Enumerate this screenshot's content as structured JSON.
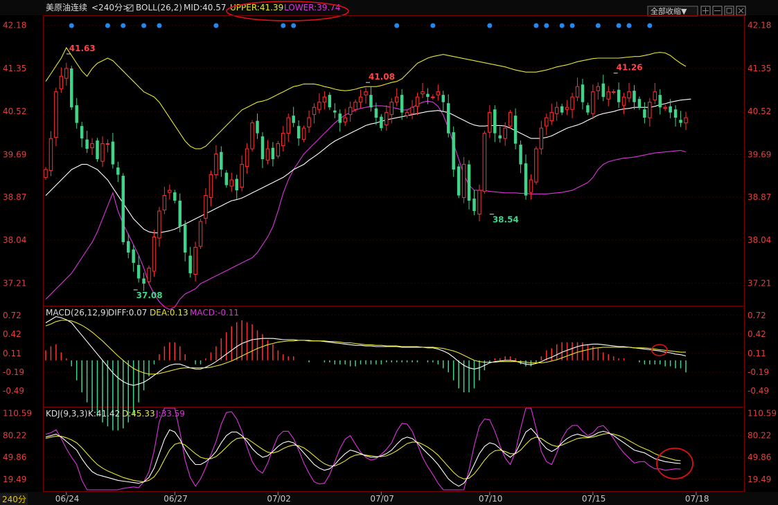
{
  "toolbar": {
    "instrument": "美原油连续",
    "period": "<240分>",
    "all_collapse_label": "全部收缩▼",
    "period_badge": "240分"
  },
  "chart_data": {
    "type": "candlestick",
    "colors": {
      "background": "#000000",
      "up": "#ff3232",
      "down": "#40d38a",
      "mid": "#ffffff",
      "upper": "#e6e633",
      "lower": "#dd33dd",
      "axis_text": "#e04040",
      "date_text": "#c8c8c8",
      "grid": "#3a0000",
      "markers": "#2288ee"
    },
    "price_panel": {
      "indicator": "BOLL(26,2)",
      "mid_label": "MID:40.57",
      "upper_label": "UPPER:41.39",
      "lower_label": "LOWER:39.74",
      "ylim": [
        36.8,
        42.35
      ],
      "y_ticks": [
        "42.18",
        "41.35",
        "40.52",
        "39.69",
        "38.87",
        "38.04",
        "37.21"
      ],
      "y_tick_values": [
        42.18,
        41.35,
        40.52,
        39.69,
        38.87,
        38.04,
        37.21
      ],
      "x_labels": [
        "06/24",
        "06/27",
        "07/02",
        "07/07",
        "07/10",
        "07/15",
        "07/18"
      ],
      "x_label_index": [
        4,
        25,
        45,
        65,
        86,
        106,
        126
      ],
      "annotations": [
        {
          "text": "41.63",
          "index": 4,
          "value": 41.63,
          "pos": "above"
        },
        {
          "text": "37.08",
          "index": 17,
          "value": 37.08,
          "pos": "below"
        },
        {
          "text": "41.08",
          "index": 62,
          "value": 41.08,
          "pos": "above"
        },
        {
          "text": "38.54",
          "index": 86,
          "value": 38.54,
          "pos": "below"
        },
        {
          "text": "41.26",
          "index": 110,
          "value": 41.26,
          "pos": "above"
        }
      ],
      "marker_index": [
        5,
        12,
        15,
        19,
        22,
        33,
        46,
        48,
        68,
        75,
        86,
        95,
        97,
        100,
        102,
        107,
        111,
        113,
        117
      ],
      "close": [
        39.4,
        40.0,
        40.9,
        41.2,
        41.35,
        40.6,
        40.3,
        40.0,
        39.8,
        39.9,
        39.6,
        39.9,
        39.9,
        39.5,
        39.3,
        38.0,
        37.8,
        37.6,
        37.3,
        37.2,
        37.5,
        38.1,
        38.6,
        38.9,
        39.0,
        38.8,
        38.3,
        37.8,
        37.4,
        37.9,
        38.4,
        38.9,
        39.3,
        39.7,
        39.4,
        39.1,
        39.2,
        39.0,
        39.5,
        39.8,
        40.3,
        40.1,
        39.6,
        39.8,
        39.6,
        39.9,
        40.1,
        40.4,
        40.3,
        40.0,
        40.2,
        40.4,
        40.6,
        40.7,
        40.8,
        40.6,
        40.5,
        40.3,
        40.4,
        40.6,
        40.7,
        40.8,
        40.9,
        40.6,
        40.4,
        40.2,
        40.5,
        40.7,
        40.8,
        40.5,
        40.5,
        40.6,
        40.8,
        40.9,
        40.8,
        40.8,
        40.9,
        40.7,
        40.1,
        39.4,
        38.9,
        39.5,
        38.8,
        38.6,
        39.0,
        40.1,
        40.5,
        40.1,
        40.0,
        40.2,
        40.5,
        39.9,
        39.5,
        38.9,
        39.2,
        39.8,
        40.2,
        40.4,
        40.5,
        40.6,
        40.5,
        40.6,
        40.8,
        41.0,
        40.7,
        40.5,
        40.9,
        41.0,
        40.8,
        40.9,
        40.9,
        40.7,
        40.8,
        40.9,
        40.7,
        40.6,
        40.4,
        40.7,
        40.9,
        40.6,
        40.6,
        40.5,
        40.4,
        40.3,
        40.4
      ],
      "mid": [
        38.9,
        39.0,
        39.1,
        39.2,
        39.3,
        39.4,
        39.45,
        39.5,
        39.5,
        39.45,
        39.4,
        39.3,
        39.2,
        39.05,
        38.9,
        38.75,
        38.6,
        38.45,
        38.35,
        38.25,
        38.2,
        38.18,
        38.18,
        38.2,
        38.22,
        38.25,
        38.3,
        38.35,
        38.4,
        38.45,
        38.5,
        38.55,
        38.6,
        38.65,
        38.7,
        38.75,
        38.8,
        38.82,
        38.85,
        38.9,
        38.95,
        39.0,
        39.05,
        39.1,
        39.15,
        39.2,
        39.25,
        39.32,
        39.4,
        39.45,
        39.5,
        39.58,
        39.65,
        39.72,
        39.8,
        39.88,
        39.95,
        40.0,
        40.05,
        40.1,
        40.15,
        40.2,
        40.25,
        40.28,
        40.3,
        40.33,
        40.36,
        40.38,
        40.4,
        40.42,
        40.44,
        40.46,
        40.48,
        40.5,
        40.52,
        40.53,
        40.54,
        40.52,
        40.5,
        40.45,
        40.4,
        40.35,
        40.3,
        40.26,
        40.24,
        40.24,
        40.25,
        40.25,
        40.25,
        40.24,
        40.2,
        40.15,
        40.1,
        40.05,
        40.0,
        40.0,
        40.0,
        40.02,
        40.05,
        40.1,
        40.15,
        40.2,
        40.23,
        40.26,
        40.3,
        40.35,
        40.4,
        40.45,
        40.48,
        40.5,
        40.52,
        40.55,
        40.57,
        40.58,
        40.6,
        40.6,
        40.6,
        40.6,
        40.62,
        40.65,
        40.67,
        40.7,
        40.72,
        40.74,
        40.75,
        40.76
      ],
      "upper": [
        41.1,
        41.25,
        41.4,
        41.55,
        41.75,
        41.6,
        41.45,
        41.3,
        41.2,
        41.35,
        41.45,
        41.5,
        41.55,
        41.5,
        41.4,
        41.3,
        41.2,
        41.1,
        41.0,
        40.9,
        40.85,
        40.8,
        40.7,
        40.55,
        40.4,
        40.25,
        40.1,
        39.95,
        39.85,
        39.8,
        39.8,
        39.85,
        39.95,
        40.05,
        40.15,
        40.25,
        40.35,
        40.45,
        40.55,
        40.6,
        40.65,
        40.7,
        40.72,
        40.75,
        40.8,
        40.85,
        40.9,
        40.95,
        41.0,
        41.02,
        41.05,
        41.05,
        41.05,
        41.03,
        41.0,
        40.98,
        40.95,
        40.93,
        40.92,
        40.93,
        40.95,
        40.98,
        41.0,
        41.0,
        41.0,
        41.02,
        41.05,
        41.08,
        41.1,
        41.15,
        41.25,
        41.35,
        41.45,
        41.5,
        41.55,
        41.58,
        41.6,
        41.62,
        41.6,
        41.58,
        41.56,
        41.54,
        41.52,
        41.5,
        41.48,
        41.46,
        41.44,
        41.42,
        41.4,
        41.38,
        41.35,
        41.32,
        41.3,
        41.28,
        41.28,
        41.28,
        41.3,
        41.32,
        41.35,
        41.38,
        41.4,
        41.42,
        41.45,
        41.48,
        41.5,
        41.52,
        41.54,
        41.55,
        41.55,
        41.55,
        41.55,
        41.55,
        41.56,
        41.57,
        41.58,
        41.58,
        41.6,
        41.62,
        41.65,
        41.66,
        41.65,
        41.6,
        41.52,
        41.45,
        41.39
      ],
      "lower": [
        36.9,
        37.0,
        37.1,
        37.2,
        37.3,
        37.4,
        37.55,
        37.7,
        37.85,
        38.0,
        38.2,
        38.45,
        38.7,
        38.95,
        38.6,
        38.35,
        38.15,
        37.95,
        37.75,
        37.5,
        37.2,
        37.0,
        36.85,
        36.75,
        36.7,
        36.75,
        36.9,
        37.0,
        37.05,
        37.1,
        37.2,
        37.25,
        37.3,
        37.35,
        37.4,
        37.45,
        37.5,
        37.55,
        37.6,
        37.65,
        37.7,
        37.8,
        37.95,
        38.1,
        38.3,
        38.6,
        38.95,
        39.2,
        39.4,
        39.55,
        39.7,
        39.8,
        39.9,
        40.0,
        40.1,
        40.2,
        40.3,
        40.38,
        40.45,
        40.5,
        40.55,
        40.58,
        40.6,
        40.62,
        40.63,
        40.63,
        40.62,
        40.6,
        40.58,
        40.55,
        40.55,
        40.6,
        40.65,
        40.7,
        40.72,
        40.7,
        40.62,
        40.45,
        40.2,
        39.9,
        39.6,
        39.3,
        39.1,
        39.0,
        39.0,
        39.0,
        38.98,
        38.97,
        38.96,
        38.95,
        38.95,
        38.95,
        38.94,
        38.94,
        38.93,
        38.93,
        38.93,
        38.93,
        38.94,
        38.95,
        38.96,
        38.98,
        39.0,
        39.05,
        39.1,
        39.15,
        39.25,
        39.4,
        39.5,
        39.55,
        39.58,
        39.6,
        39.62,
        39.63,
        39.64,
        39.66,
        39.68,
        39.7,
        39.72,
        39.73,
        39.74,
        39.75,
        39.76,
        39.77,
        39.74
      ]
    },
    "macd_panel": {
      "title": "MACD(26,12,9)",
      "diff_label": "DIFF:0.07",
      "dea_label": "DEA:0.13",
      "macd_label": "MACD:-0.11",
      "y_ticks": [
        "0.72",
        "0.42",
        "0.11",
        "-0.19",
        "-0.49"
      ],
      "y_tick_values": [
        0.72,
        0.42,
        0.11,
        -0.19,
        -0.49
      ],
      "ylim": [
        -0.72,
        0.85
      ],
      "diff": [
        0.6,
        0.65,
        0.7,
        0.68,
        0.65,
        0.6,
        0.5,
        0.4,
        0.3,
        0.2,
        0.1,
        0.0,
        -0.1,
        -0.2,
        -0.28,
        -0.34,
        -0.38,
        -0.4,
        -0.38,
        -0.35,
        -0.3,
        -0.24,
        -0.18,
        -0.12,
        -0.08,
        -0.06,
        -0.06,
        -0.09,
        -0.12,
        -0.14,
        -0.14,
        -0.11,
        -0.07,
        -0.02,
        0.04,
        0.1,
        0.16,
        0.22,
        0.27,
        0.3,
        0.33,
        0.34,
        0.35,
        0.35,
        0.35,
        0.34,
        0.33,
        0.33,
        0.33,
        0.32,
        0.32,
        0.31,
        0.31,
        0.31,
        0.3,
        0.29,
        0.28,
        0.27,
        0.26,
        0.25,
        0.24,
        0.24,
        0.23,
        0.23,
        0.22,
        0.22,
        0.22,
        0.22,
        0.22,
        0.21,
        0.21,
        0.21,
        0.21,
        0.21,
        0.2,
        0.2,
        0.18,
        0.15,
        0.11,
        0.05,
        -0.02,
        -0.08,
        -0.12,
        -0.14,
        -0.12,
        -0.08,
        -0.04,
        -0.02,
        -0.01,
        0.0,
        0.0,
        -0.01,
        -0.04,
        -0.06,
        -0.07,
        -0.05,
        -0.02,
        0.02,
        0.05,
        0.09,
        0.13,
        0.16,
        0.19,
        0.22,
        0.24,
        0.25,
        0.26,
        0.26,
        0.25,
        0.24,
        0.23,
        0.22,
        0.22,
        0.21,
        0.2,
        0.19,
        0.18,
        0.17,
        0.16,
        0.15,
        0.13,
        0.12,
        0.1,
        0.09,
        0.07
      ],
      "dea": [
        0.55,
        0.58,
        0.62,
        0.64,
        0.64,
        0.63,
        0.6,
        0.56,
        0.51,
        0.45,
        0.38,
        0.31,
        0.23,
        0.15,
        0.07,
        0.0,
        -0.07,
        -0.13,
        -0.17,
        -0.2,
        -0.22,
        -0.22,
        -0.21,
        -0.19,
        -0.17,
        -0.15,
        -0.13,
        -0.12,
        -0.12,
        -0.12,
        -0.12,
        -0.12,
        -0.11,
        -0.09,
        -0.07,
        -0.04,
        -0.01,
        0.03,
        0.07,
        0.11,
        0.15,
        0.19,
        0.22,
        0.25,
        0.27,
        0.29,
        0.3,
        0.31,
        0.31,
        0.32,
        0.32,
        0.32,
        0.31,
        0.31,
        0.31,
        0.3,
        0.3,
        0.29,
        0.28,
        0.28,
        0.27,
        0.26,
        0.25,
        0.25,
        0.24,
        0.24,
        0.23,
        0.23,
        0.23,
        0.22,
        0.22,
        0.22,
        0.22,
        0.21,
        0.21,
        0.21,
        0.2,
        0.19,
        0.17,
        0.15,
        0.12,
        0.08,
        0.04,
        0.0,
        -0.02,
        -0.03,
        -0.03,
        -0.03,
        -0.02,
        -0.02,
        -0.02,
        -0.02,
        -0.02,
        -0.03,
        -0.04,
        -0.04,
        -0.04,
        -0.03,
        -0.01,
        0.01,
        0.04,
        0.07,
        0.1,
        0.13,
        0.15,
        0.17,
        0.19,
        0.2,
        0.21,
        0.21,
        0.21,
        0.21,
        0.21,
        0.21,
        0.2,
        0.2,
        0.2,
        0.19,
        0.18,
        0.17,
        0.16,
        0.15,
        0.14,
        0.13,
        0.13
      ]
    },
    "kdj_panel": {
      "title": "KDJ(9,3,3)",
      "k_label": "K:41.42",
      "d_label": "D:45.33",
      "j_label": "J:33.59",
      "y_ticks": [
        "110.59",
        "80.22",
        "49.86",
        "19.49"
      ],
      "y_tick_values": [
        110.59,
        80.22,
        49.86,
        19.49
      ],
      "ylim": [
        5,
        118
      ],
      "k": [
        78,
        80,
        82,
        78,
        72,
        66,
        60,
        48,
        38,
        30,
        26,
        24,
        22,
        20,
        18,
        17,
        16,
        15,
        14,
        16,
        22,
        35,
        55,
        75,
        88,
        85,
        75,
        60,
        48,
        40,
        40,
        44,
        50,
        58,
        70,
        80,
        85,
        85,
        80,
        72,
        62,
        55,
        50,
        52,
        58,
        65,
        70,
        72,
        70,
        64,
        56,
        48,
        40,
        35,
        32,
        34,
        40,
        48,
        55,
        60,
        58,
        55,
        52,
        50,
        50,
        52,
        55,
        60,
        68,
        75,
        78,
        76,
        70,
        62,
        55,
        48,
        40,
        30,
        20,
        14,
        10,
        14,
        25,
        40,
        55,
        65,
        70,
        68,
        62,
        55,
        50,
        56,
        70,
        85,
        90,
        82,
        70,
        62,
        58,
        62,
        70,
        76,
        80,
        82,
        80,
        78,
        80,
        84,
        86,
        84,
        80,
        75,
        70,
        65,
        60,
        58,
        56,
        52,
        48,
        46,
        44,
        43,
        42,
        41.4
      ],
      "d": [
        76,
        78,
        79,
        79,
        77,
        74,
        70,
        63,
        55,
        47,
        40,
        35,
        31,
        28,
        25,
        22,
        20,
        18,
        17,
        16,
        18,
        23,
        33,
        47,
        60,
        68,
        70,
        67,
        61,
        55,
        50,
        48,
        48,
        51,
        57,
        64,
        71,
        76,
        77,
        76,
        71,
        66,
        61,
        57,
        56,
        58,
        62,
        65,
        67,
        66,
        63,
        58,
        52,
        46,
        41,
        38,
        38,
        41,
        45,
        50,
        53,
        54,
        53,
        52,
        51,
        51,
        52,
        55,
        59,
        64,
        69,
        71,
        71,
        68,
        64,
        59,
        53,
        45,
        37,
        29,
        23,
        20,
        21,
        27,
        36,
        46,
        54,
        59,
        60,
        58,
        55,
        55,
        60,
        68,
        75,
        78,
        76,
        71,
        67,
        65,
        67,
        70,
        73,
        76,
        77,
        77,
        78,
        80,
        82,
        83,
        82,
        80,
        77,
        73,
        69,
        65,
        62,
        59,
        55,
        52,
        50,
        48,
        46,
        45.3
      ],
      "j": [
        82,
        84,
        88,
        76,
        62,
        50,
        40,
        18,
        4,
        -4,
        -2,
        2,
        4,
        4,
        4,
        7,
        8,
        9,
        8,
        16,
        30,
        59,
        99,
        131,
        144,
        119,
        85,
        46,
        22,
        10,
        20,
        36,
        54,
        72,
        96,
        112,
        113,
        103,
        86,
        64,
        44,
        33,
        28,
        42,
        62,
        79,
        86,
        86,
        76,
        60,
        42,
        28,
        16,
        13,
        14,
        26,
        44,
        62,
        75,
        80,
        68,
        57,
        50,
        46,
        48,
        54,
        61,
        70,
        86,
        97,
        96,
        86,
        68,
        50,
        37,
        26,
        14,
        0,
        -14,
        -16,
        -16,
        2,
        33,
        66,
        93,
        103,
        102,
        86,
        66,
        49,
        40,
        58,
        90,
        119,
        120,
        90,
        58,
        44,
        40,
        56,
        76,
        88,
        94,
        94,
        86,
        80,
        84,
        92,
        94,
        86,
        76,
        65,
        56,
        49,
        42,
        44,
        44,
        38,
        34,
        34,
        32,
        33,
        34,
        33.6
      ]
    }
  }
}
